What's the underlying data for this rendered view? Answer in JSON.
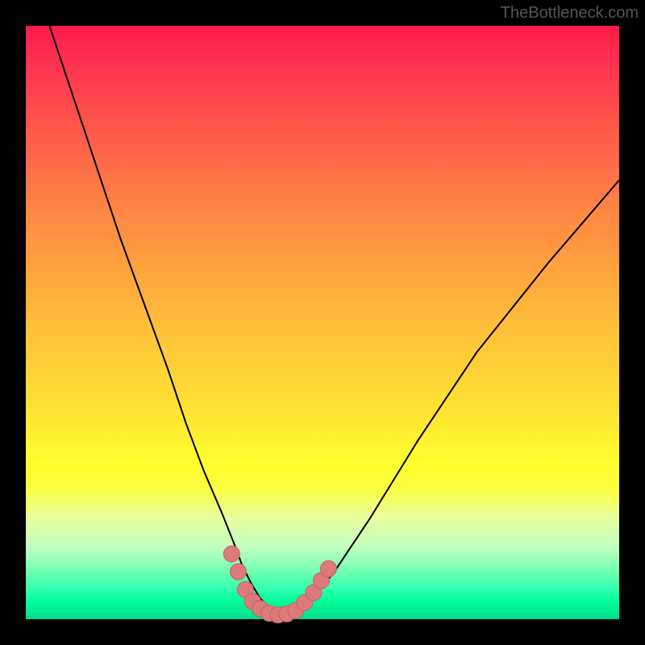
{
  "watermark": "TheBottleneck.com",
  "chart_data": {
    "type": "line",
    "title": "",
    "xlabel": "",
    "ylabel": "",
    "xlim": [
      0,
      100
    ],
    "ylim": [
      0,
      100
    ],
    "series": [
      {
        "name": "curve",
        "x": [
          4,
          8,
          12,
          16,
          20,
          24,
          27,
          30,
          33,
          35,
          36.5,
          38,
          39.5,
          41,
          42.5,
          44,
          46,
          48,
          52,
          58,
          66,
          76,
          88,
          100
        ],
        "y": [
          100,
          88,
          76,
          64,
          53,
          42,
          33,
          25,
          18,
          13,
          9,
          6,
          3.5,
          2,
          1,
          0.7,
          1.2,
          3,
          8,
          17,
          30,
          45,
          60,
          74
        ]
      }
    ],
    "markers": [
      {
        "x": 34.7,
        "y": 11
      },
      {
        "x": 35.8,
        "y": 8
      },
      {
        "x": 37.0,
        "y": 5
      },
      {
        "x": 38.2,
        "y": 3
      },
      {
        "x": 39.5,
        "y": 1.8
      },
      {
        "x": 41.0,
        "y": 1
      },
      {
        "x": 42.5,
        "y": 0.7
      },
      {
        "x": 44.0,
        "y": 0.9
      },
      {
        "x": 45.5,
        "y": 1.5
      },
      {
        "x": 47.0,
        "y": 2.8
      },
      {
        "x": 48.5,
        "y": 4.5
      },
      {
        "x": 49.8,
        "y": 6.5
      },
      {
        "x": 51.0,
        "y": 8.5
      }
    ],
    "marker_radius_px": 10,
    "background_gradient": {
      "top": "#ff1a4a",
      "mid_upper": "#ffa63e",
      "mid": "#ffff2e",
      "lower": "#70ffb0",
      "bottom": "#00d888"
    }
  }
}
